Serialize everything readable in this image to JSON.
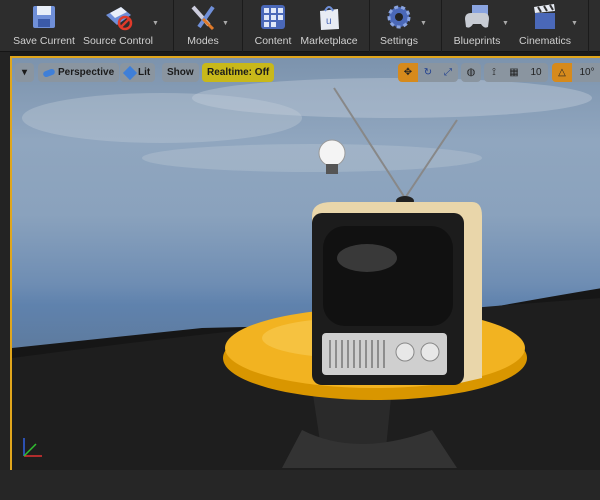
{
  "toolbar": {
    "items": [
      {
        "label": "Save Current",
        "icon": "floppy-disk-icon"
      },
      {
        "label": "Source Control",
        "icon": "source-control-icon"
      },
      {
        "label": "Modes",
        "icon": "tools-icon"
      },
      {
        "label": "Content",
        "icon": "content-grid-icon"
      },
      {
        "label": "Marketplace",
        "icon": "marketplace-bag-icon"
      },
      {
        "label": "Settings",
        "icon": "gear-icon"
      },
      {
        "label": "Blueprints",
        "icon": "gamepad-icon"
      },
      {
        "label": "Cinematics",
        "icon": "clapperboard-icon"
      }
    ]
  },
  "viewport": {
    "perspective": "Perspective",
    "lit": "Lit",
    "show": "Show",
    "realtime": "Realtime: Off",
    "grid_snap": "10",
    "rotation_snap": "10°",
    "colors": {
      "accent": "#e0a61c",
      "realtime_bg": "#c8b81a"
    }
  }
}
